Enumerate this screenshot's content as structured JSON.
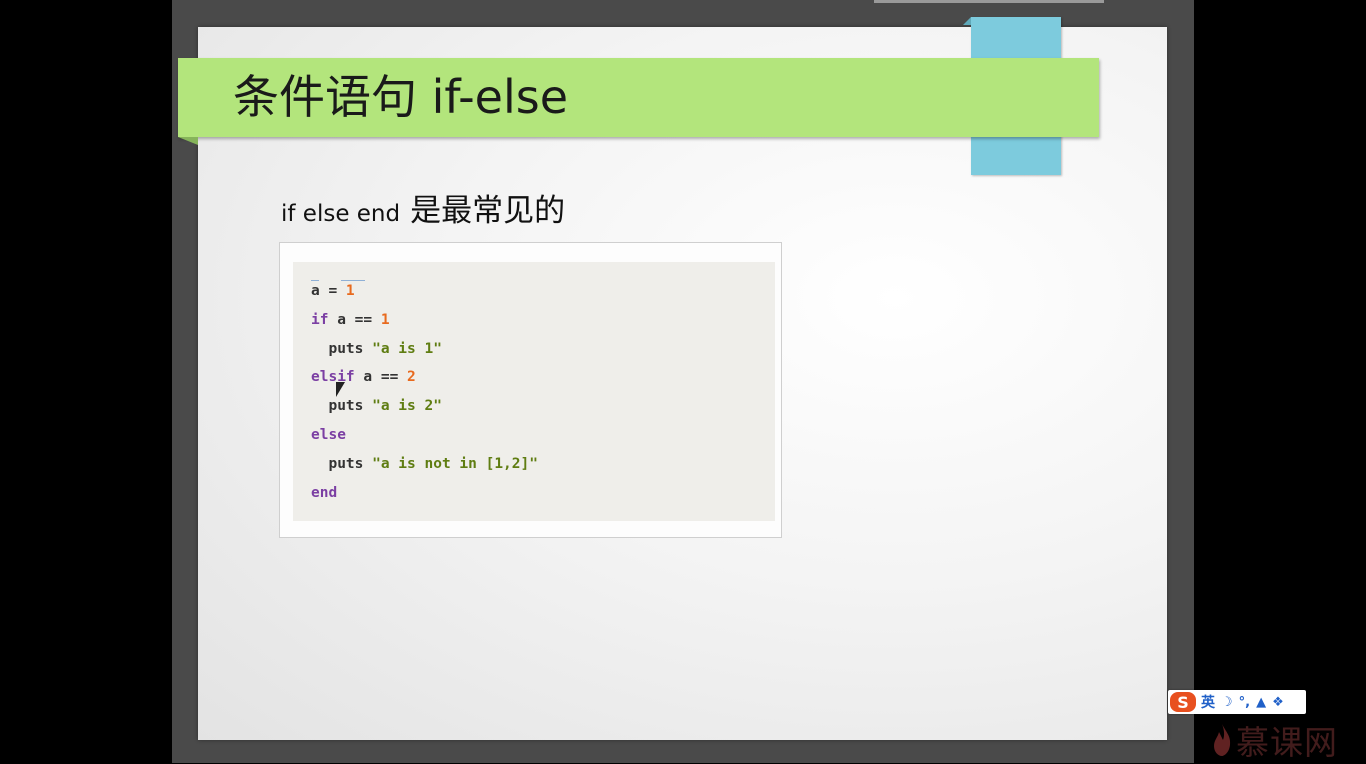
{
  "slide": {
    "title": "条件语句  if-else",
    "subtitle_en": "if else end",
    "subtitle_zh": "是最常见的"
  },
  "code": {
    "lines": [
      [
        {
          "t": "a = ",
          "c": "plain"
        },
        {
          "t": "1",
          "c": "num"
        }
      ],
      [
        {
          "t": "if",
          "c": "kw"
        },
        {
          "t": " a == ",
          "c": "plain"
        },
        {
          "t": "1",
          "c": "num"
        }
      ],
      [
        {
          "t": "  puts ",
          "c": "plain"
        },
        {
          "t": "\"a is 1\"",
          "c": "str"
        }
      ],
      [
        {
          "t": "elsif",
          "c": "kw"
        },
        {
          "t": " a == ",
          "c": "plain"
        },
        {
          "t": "2",
          "c": "num"
        }
      ],
      [
        {
          "t": "  puts ",
          "c": "plain"
        },
        {
          "t": "\"a is 2\"",
          "c": "str"
        }
      ],
      [
        {
          "t": "else",
          "c": "kw"
        }
      ],
      [
        {
          "t": "  puts ",
          "c": "plain"
        },
        {
          "t": "\"a is not in [1,2]\"",
          "c": "str"
        }
      ],
      [
        {
          "t": "end",
          "c": "kw"
        }
      ]
    ]
  },
  "ime_toolbar": {
    "logo": "S",
    "lang": "英",
    "icons": [
      "moon-icon",
      "punctuation-icon",
      "shirt-icon",
      "wrench-icon"
    ]
  },
  "watermark": {
    "text": "慕课网"
  }
}
